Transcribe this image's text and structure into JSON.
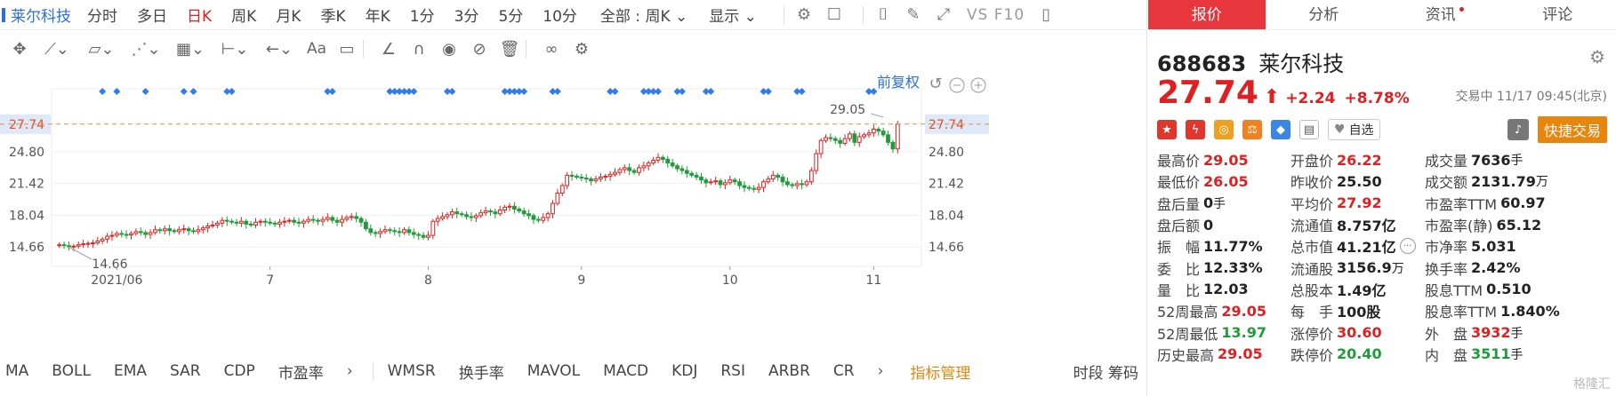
{
  "symbol_tab": "莱尔科技",
  "periods": [
    "分时",
    "多日",
    "日K",
    "周K",
    "月K",
    "季K",
    "年K",
    "1分",
    "3分",
    "5分",
    "10分"
  ],
  "active_period": "日K",
  "full_select": "全部 : 周K",
  "display_label": "显示",
  "vs_label": "VS F10",
  "toolbar": {
    "aa": "Aa"
  },
  "chart_overlay": {
    "fq_label": "前复权",
    "price_tag": "27.74",
    "hi_label": "29.05",
    "lo_label": "14.66"
  },
  "indicators": [
    "MA",
    "BOLL",
    "EMA",
    "SAR",
    "CDP",
    "市盈率"
  ],
  "indicators2": [
    "WMSR",
    "换手率",
    "MAVOL",
    "MACD",
    "KDJ",
    "RSI",
    "ARBR",
    "CR"
  ],
  "indicator_mgmt": "指标管理",
  "bottom_right": "时段 筹码",
  "right_tabs": [
    "报价",
    "分析",
    "资讯",
    "评论"
  ],
  "stock": {
    "code": "688683",
    "name": "莱尔科技",
    "price": "27.74",
    "change": "+2.24",
    "change_pct": "+8.78%",
    "trade_status": "交易中 11/17 09:45(北京)",
    "watch_label": "自选",
    "quick_trade": "快捷交易"
  },
  "stats": [
    [
      {
        "k": "最高价",
        "v": "29.05",
        "c": "red"
      },
      {
        "k": "开盘价",
        "v": "26.22",
        "c": "red"
      },
      {
        "k": "成交量",
        "v": "7636",
        "u": "手"
      }
    ],
    [
      {
        "k": "最低价",
        "v": "26.05",
        "c": "red"
      },
      {
        "k": "昨收价",
        "v": "25.50"
      },
      {
        "k": "成交额",
        "v": "2131.79",
        "u": "万"
      }
    ],
    [
      {
        "k": "盘后量",
        "v": "0",
        "u": "手"
      },
      {
        "k": "平均价",
        "v": "27.92",
        "c": "red"
      },
      {
        "k": "市盈率TTM",
        "v": "60.97"
      }
    ],
    [
      {
        "k": "盘后额",
        "v": "0"
      },
      {
        "k": "流通值",
        "v": "8.757亿"
      },
      {
        "k": "市盈率(静)",
        "v": "65.12"
      }
    ],
    [
      {
        "k": "振　幅",
        "v": "11.77%"
      },
      {
        "k": "总市值",
        "v": "41.21亿",
        "more": true
      },
      {
        "k": "市净率",
        "v": "5.031"
      }
    ],
    [
      {
        "k": "委　比",
        "v": "12.33%"
      },
      {
        "k": "流通股",
        "v": "3156.9",
        "u": "万"
      },
      {
        "k": "换手率",
        "v": "2.42%"
      }
    ],
    [
      {
        "k": "量　比",
        "v": "12.03"
      },
      {
        "k": "总股本",
        "v": "1.49亿"
      },
      {
        "k": "股息TTM",
        "v": "0.510"
      }
    ],
    [
      {
        "k": "52周最高",
        "v": "29.05",
        "c": "red"
      },
      {
        "k": "每　手",
        "v": "100股"
      },
      {
        "k": "股息率TTM",
        "v": "1.840%"
      }
    ],
    [
      {
        "k": "52周最低",
        "v": "13.97",
        "c": "green"
      },
      {
        "k": "涨停价",
        "v": "30.60",
        "c": "red"
      },
      {
        "k": "外　盘",
        "v": "3932",
        "u": "手",
        "c": "red"
      }
    ],
    [
      {
        "k": "历史最高",
        "v": "29.05",
        "c": "red"
      },
      {
        "k": "跌停价",
        "v": "20.40",
        "c": "green"
      },
      {
        "k": "内　盘",
        "v": "3511",
        "u": "手",
        "c": "green"
      }
    ]
  ],
  "watermark": "格隆汇",
  "chart_data": {
    "type": "candlestick",
    "y_ticks": [
      27.74,
      24.8,
      21.42,
      18.04,
      14.66
    ],
    "ylim": [
      12.6,
      31.5
    ],
    "x_tick_labels": [
      "2021/06",
      "7",
      "8",
      "9",
      "10",
      "11"
    ],
    "x_tick_index": [
      12,
      44,
      77,
      109,
      140,
      170
    ],
    "last_price": 27.74,
    "up_color": "#e02020",
    "down_color": "#1e9c3a",
    "closes": [
      14.9,
      14.8,
      14.7,
      14.75,
      14.9,
      15.0,
      15.05,
      15.1,
      15.3,
      15.5,
      15.8,
      15.9,
      16.1,
      16.0,
      15.95,
      16.1,
      16.3,
      16.2,
      16.0,
      16.2,
      16.5,
      16.4,
      16.6,
      16.4,
      16.3,
      16.5,
      16.6,
      16.4,
      16.3,
      16.5,
      16.7,
      16.9,
      17.0,
      17.2,
      17.5,
      17.4,
      17.3,
      17.2,
      17.4,
      17.1,
      17.0,
      17.3,
      17.4,
      17.3,
      17.2,
      17.1,
      17.3,
      17.4,
      17.5,
      17.3,
      17.2,
      17.4,
      17.6,
      17.5,
      17.4,
      17.6,
      17.8,
      17.5,
      17.3,
      17.6,
      17.8,
      17.9,
      17.7,
      17.3,
      16.6,
      16.2,
      16.1,
      16.3,
      16.5,
      16.4,
      16.3,
      16.2,
      16.5,
      16.2,
      16.0,
      15.9,
      15.7,
      15.9,
      17.4,
      17.7,
      17.9,
      18.1,
      18.4,
      18.2,
      18.1,
      17.9,
      17.8,
      18.0,
      18.3,
      18.5,
      18.4,
      18.2,
      18.6,
      18.9,
      19.0,
      18.7,
      18.5,
      18.2,
      18.0,
      17.6,
      17.5,
      17.8,
      18.2,
      19.3,
      20.4,
      21.2,
      22.3,
      22.2,
      22.1,
      22.0,
      21.9,
      21.7,
      21.9,
      22.1,
      22.2,
      22.4,
      22.6,
      22.9,
      23.1,
      22.8,
      22.6,
      23.1,
      23.3,
      23.6,
      23.9,
      24.2,
      24.0,
      23.6,
      23.3,
      23.0,
      22.8,
      22.5,
      22.3,
      22.1,
      21.8,
      21.5,
      21.6,
      21.7,
      21.3,
      21.5,
      21.8,
      21.6,
      21.2,
      21.0,
      20.9,
      20.8,
      21.0,
      21.6,
      21.9,
      22.3,
      22.1,
      21.6,
      21.3,
      21.2,
      21.4,
      21.3,
      21.6,
      22.8,
      24.6,
      26.0,
      26.3,
      26.2,
      26.0,
      25.7,
      26.2,
      26.7,
      25.8,
      26.4,
      26.6,
      26.8,
      27.2,
      27.0,
      26.6,
      25.8,
      25.1,
      27.74
    ]
  }
}
